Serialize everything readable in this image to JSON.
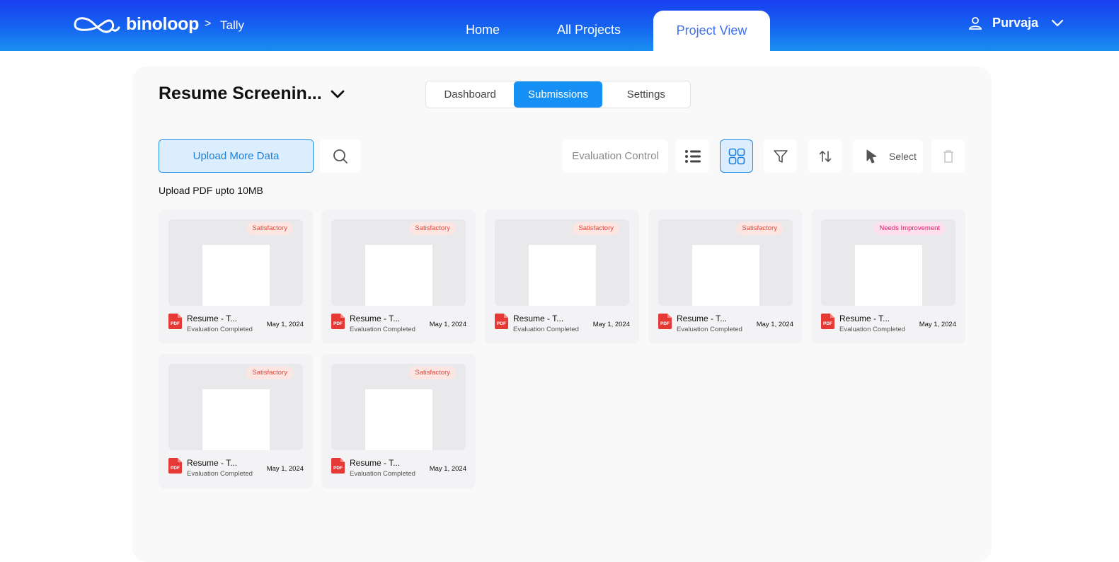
{
  "header": {
    "brand": "binoloop",
    "breadcrumb_separator": ">",
    "breadcrumb": "Tally",
    "nav": {
      "home": "Home",
      "all_projects": "All Projects",
      "project_view": "Project View"
    },
    "user": "Purvaja"
  },
  "project": {
    "title": "Resume Screenin...",
    "tabs": {
      "dashboard": "Dashboard",
      "submissions": "Submissions",
      "settings": "Settings"
    },
    "active_tab": "Submissions"
  },
  "toolbar": {
    "upload_label": "Upload More Data",
    "evaluation_control": "Evaluation Control",
    "select_label": "Select",
    "view_mode": "grid"
  },
  "upload_note": "Upload PDF upto 10MB",
  "cards": [
    {
      "badge": "Satisfactory",
      "name": "Resume - T...",
      "status": "Evaluation Completed",
      "date": "May 1, 2024"
    },
    {
      "badge": "Satisfactory",
      "name": "Resume - T...",
      "status": "Evaluation Completed",
      "date": "May 1, 2024"
    },
    {
      "badge": "Satisfactory",
      "name": "Resume - T...",
      "status": "Evaluation Completed",
      "date": "May 1, 2024"
    },
    {
      "badge": "Satisfactory",
      "name": "Resume - T...",
      "status": "Evaluation Completed",
      "date": "May 1, 2024"
    },
    {
      "badge": "Needs Improvement",
      "name": "Resume - T...",
      "status": "Evaluation Completed",
      "date": "May 1, 2024"
    },
    {
      "badge": "Satisfactory",
      "name": "Resume - T...",
      "status": "Evaluation Completed",
      "date": "May 1, 2024"
    },
    {
      "badge": "Satisfactory",
      "name": "Resume - T...",
      "status": "Evaluation Completed",
      "date": "May 1, 2024"
    }
  ],
  "colors": {
    "accent": "#1690f5",
    "header_start": "#1a3ff0",
    "header_end": "#1a8ff0",
    "satisfactory": "#e2473a",
    "needs_improvement": "#d81b6a"
  }
}
